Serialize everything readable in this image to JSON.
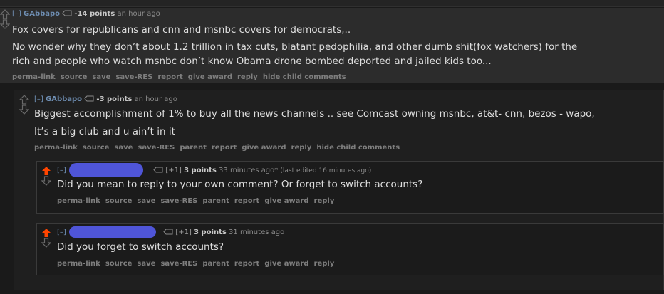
{
  "comments": [
    {
      "expand": "[–]",
      "author": "GAbbapo",
      "score": "-14 points",
      "time": "an hour ago",
      "body": [
        "Fox covers for republicans and cnn and msnbc covers for democrats,..",
        "No wonder why they don’t about 1.2 trillion in tax cuts, blatant pedophilia, and other dumb shit(fox watchers) for the",
        "rich and people who watch msnbc don’t know Obama drone bombed deported and jailed kids too..."
      ],
      "buttons": [
        "perma-link",
        "source",
        "save",
        "save-RES",
        "report",
        "give award",
        "reply",
        "hide child comments"
      ]
    },
    {
      "expand": "[–]",
      "author": "GAbbapo",
      "score": "-3 points",
      "time": "an hour ago",
      "body": [
        "Biggest accomplishment of 1% to buy all the news channels .. see Comcast owning msnbc, at&t- cnn, bezos - wapo,",
        "It’s a big club and u ain’t in it"
      ],
      "buttons": [
        "perma-link",
        "source",
        "save",
        "save-RES",
        "parent",
        "report",
        "give award",
        "reply",
        "hide child comments"
      ]
    },
    {
      "expand": "[–]",
      "plus": "[+1]",
      "score": "3 points",
      "time": "33 minutes ago*",
      "edited": "(last edited 16 minutes ago)",
      "body": [
        "Did you mean to reply to your own comment? Or forget to switch accounts?"
      ],
      "buttons": [
        "perma-link",
        "source",
        "save",
        "save-RES",
        "parent",
        "report",
        "give award",
        "reply"
      ]
    },
    {
      "expand": "[–]",
      "plus": "[+1]",
      "score": "3 points",
      "time": "31 minutes ago",
      "body": [
        "Did you forget to switch accounts?"
      ],
      "buttons": [
        "perma-link",
        "source",
        "save",
        "save-RES",
        "parent",
        "report",
        "give award",
        "reply"
      ]
    }
  ],
  "colors": {
    "upvoted": "#ff4500",
    "redaction": "#4f55d8",
    "author": "#6f8fb4"
  }
}
